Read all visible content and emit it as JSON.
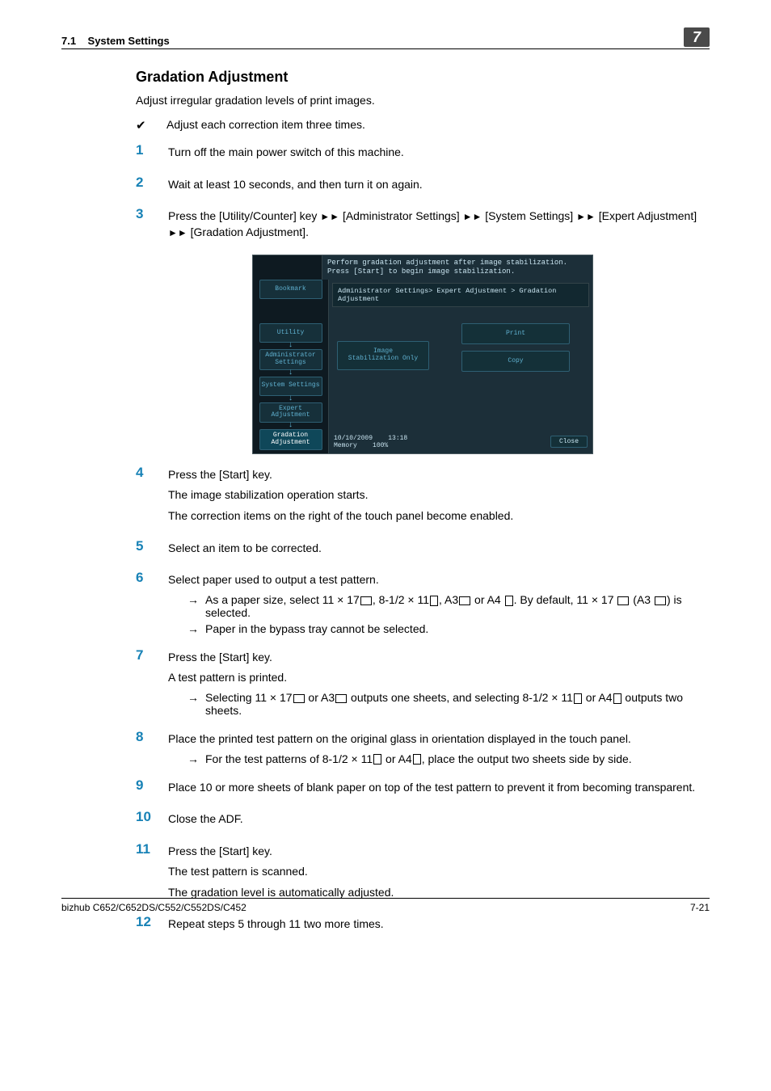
{
  "header": {
    "section_number": "7.1",
    "section_title": "System Settings",
    "chapter_number": "7"
  },
  "section": {
    "title": "Gradation Adjustment",
    "intro": "Adjust irregular gradation levels of print images.",
    "check_note": "Adjust each correction item three times."
  },
  "steps": [
    {
      "num": "1",
      "lines": [
        "Turn off the main power switch of this machine."
      ]
    },
    {
      "num": "2",
      "lines": [
        "Wait at least 10 seconds, and then turn it on again."
      ]
    },
    {
      "num": "3",
      "nav_prefix": "Press the [Utility/Counter] key ",
      "nav_parts": [
        "[Administrator Settings]",
        "[System Settings]",
        "[Expert Adjustment]",
        "[Gradation Adjustment]."
      ]
    },
    {
      "num": "4",
      "lines": [
        "Press the [Start] key.",
        "The image stabilization operation starts.",
        "The correction items on the right of the touch panel become enabled."
      ]
    },
    {
      "num": "5",
      "lines": [
        "Select an item to be corrected."
      ]
    },
    {
      "num": "6",
      "lines": [
        "Select paper used to output a test pattern."
      ],
      "subs": [
        "As a paper size, select 11 × 17⌧, 8-1/2 × 11⌧, A3⌧ or A4 ⌧. By default, 11 × 17 ⌧ (A3 ⌧) is selected.",
        "Paper in the bypass tray cannot be selected."
      ]
    },
    {
      "num": "7",
      "lines": [
        "Press the [Start] key.",
        "A test pattern is printed."
      ],
      "subs": [
        "Selecting 11 × 17⌧ or A3⌧ outputs one sheets, and selecting 8-1/2 × 11⌧ or A4⌧ outputs two sheets."
      ]
    },
    {
      "num": "8",
      "lines": [
        "Place the printed test pattern on the original glass in orientation displayed in the touch panel."
      ],
      "subs": [
        "For the test patterns of 8-1/2 × 11⌧ or A4⌧, place the output two sheets side by side."
      ]
    },
    {
      "num": "9",
      "lines": [
        "Place 10 or more sheets of blank paper on top of the test pattern to prevent it from becoming transparent."
      ]
    },
    {
      "num": "10",
      "lines": [
        "Close the ADF."
      ]
    },
    {
      "num": "11",
      "lines": [
        "Press the [Start] key.",
        "The test pattern is scanned.",
        "The gradation level is automatically adjusted."
      ]
    },
    {
      "num": "12",
      "lines": [
        "Repeat steps 5 through 11 two more times."
      ]
    }
  ],
  "touchpanel": {
    "status1": "Perform gradation adjustment after image stabilization.",
    "status2": "Press [Start] to begin image stabilization.",
    "bookmark": "Bookmark",
    "sidebar": [
      "Utility",
      "Administrator Settings",
      "System Settings",
      "Expert Adjustment",
      "Gradation Adjustment"
    ],
    "breadcrumb": "Administrator Settings> Expert Adjustment > Gradation Adjustment",
    "btn_image_stab": "Image\nStabilization Only",
    "btn_print": "Print",
    "btn_copy": "Copy",
    "date": "10/10/2009",
    "time": "13:18",
    "memory_label": "Memory",
    "memory_value": "100%",
    "close_label": "Close"
  },
  "footer": {
    "left": "bizhub C652/C652DS/C552/C552DS/C452",
    "right": "7-21"
  }
}
